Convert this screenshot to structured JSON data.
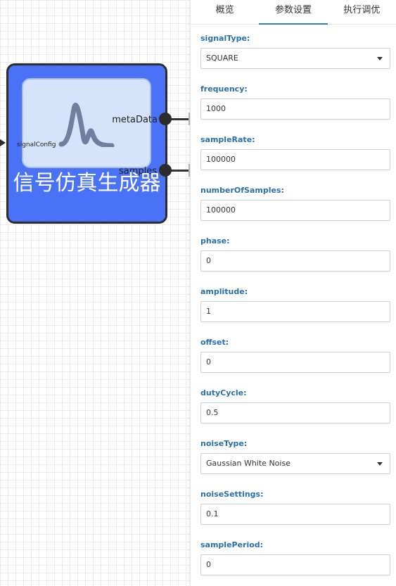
{
  "node": {
    "title": "信号仿真生成器",
    "input_port": "signalConfig",
    "output_ports": [
      "metaData",
      "samples"
    ],
    "color": "#4a72f7",
    "icon": "waveform-icon"
  },
  "tabs": [
    {
      "label": "概览",
      "active": false
    },
    {
      "label": "参数设置",
      "active": true
    },
    {
      "label": "执行调优",
      "active": false
    }
  ],
  "fields": [
    {
      "label": "signalType:",
      "value": "SQUARE",
      "type": "select"
    },
    {
      "label": "frequency:",
      "value": "1000",
      "type": "input"
    },
    {
      "label": "sampleRate:",
      "value": "100000",
      "type": "input"
    },
    {
      "label": "numberOfSamples:",
      "value": "100000",
      "type": "input"
    },
    {
      "label": "phase:",
      "value": "0",
      "type": "input"
    },
    {
      "label": "amplitude:",
      "value": "1",
      "type": "input"
    },
    {
      "label": "offset:",
      "value": "0",
      "type": "input"
    },
    {
      "label": "dutyCycle:",
      "value": "0.5",
      "type": "input"
    },
    {
      "label": "noiseType:",
      "value": "Gaussian White Noise",
      "type": "select"
    },
    {
      "label": "noiseSettings:",
      "value": "0.1",
      "type": "input"
    },
    {
      "label": "samplePeriod:",
      "value": "0",
      "type": "input"
    }
  ],
  "colors": {
    "label": "#2a6fa8",
    "tab_underline": "#2f7fcf"
  }
}
